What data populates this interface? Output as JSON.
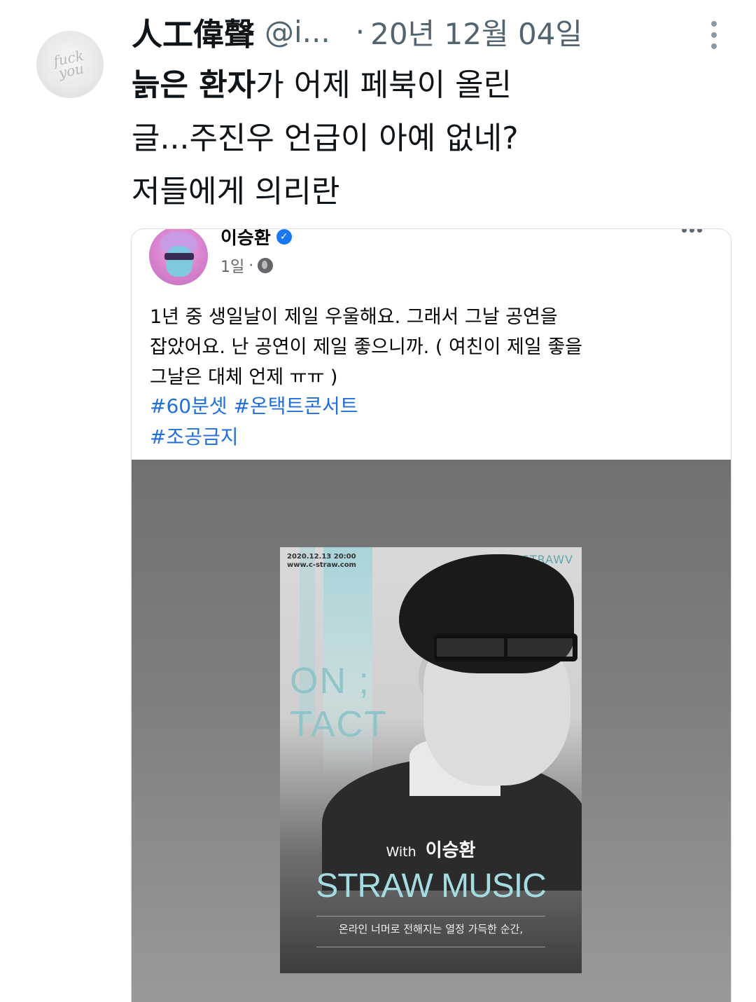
{
  "tweet": {
    "display_name": "人工偉聲",
    "handle": "@i...",
    "separator": "·",
    "date": "20년 12월 04일",
    "avatar_text": "fuck\nyou",
    "text_bold": "늙은 환자",
    "text_line1_rest": "가 어제 페북이 올린",
    "text_line2": "글...주진우 언급이 아예 없네?",
    "text_line3": "저들에게 의리란"
  },
  "facebook_post": {
    "author": "이승환",
    "verified_mark": "✓",
    "time": "1일",
    "meta_sep": "·",
    "body": [
      "1년 중 생일날이 제일 우울해요. 그래서 그날 공연을",
      "잡았어요. 난 공연이 제일 좋으니까. ( 여친이 제일 좋을",
      "그날은 대체 언제 ㅠㅠ )"
    ],
    "hashtags": [
      "#60분셋",
      "#온택트콘서트",
      "#조공금지"
    ]
  },
  "poster": {
    "date_info": "2020.12.13 20:00\nwww.c-straw.com",
    "brand": "STRAWV",
    "on_tact": "ON ;\nTACT",
    "with_prefix": "With",
    "with_name": "이승환",
    "title": "STRAW MUSIC",
    "tagline": "온라인 너머로 전해지는 열정 가득한 순간,"
  }
}
